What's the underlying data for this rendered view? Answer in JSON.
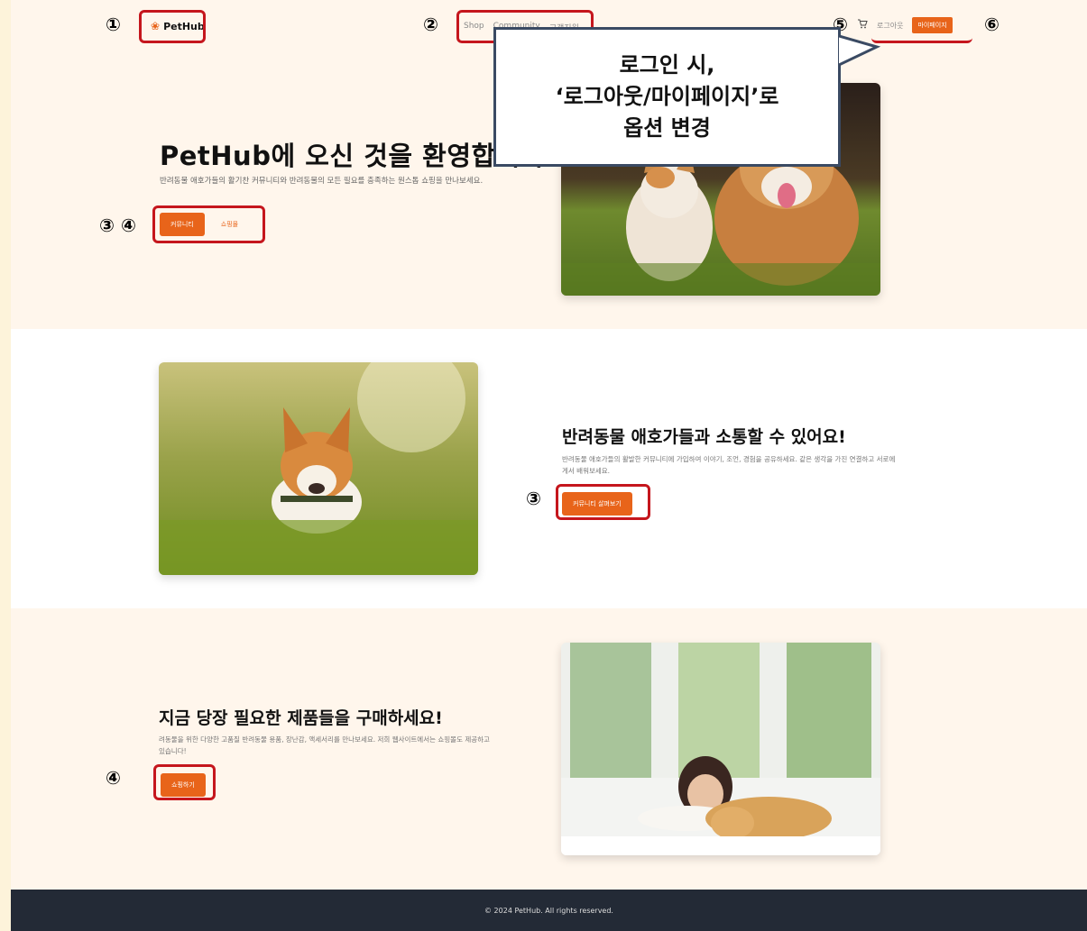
{
  "header": {
    "logo_text": "PetHub",
    "nav": [
      "Shop",
      "Community",
      "고객지원"
    ],
    "cart_icon": "cart-icon",
    "logout_label": "로그아웃",
    "mypage_label": "마이페이지"
  },
  "hero": {
    "title": "PetHub에 오신 것을 환영합니다",
    "description": "반려동물 애호가들의 활기찬 커뮤니티와 반려동물의 모든 필요를 충족하는 원스톱 쇼핑을 만나보세요.",
    "community_button": "커뮤니티",
    "shop_button": "쇼핑몰"
  },
  "community_section": {
    "title": "반려동물 애호가들과 소통할 수 있어요!",
    "description": "반려동물 애호가들의 활발한 커뮤니티에 가입하여 이야기, 조언, 경험을 공유하세요. 같은 생각을 가진 연결하고 서로에게서 배워보세요.",
    "button": "커뮤니티 살펴보기"
  },
  "shop_section": {
    "title": "지금 당장 필요한 제품들을 구매하세요!",
    "description": "려동물을 위한 다양한 고품질 반려동물 용품, 장난감, 액세서리를 만나보세요. 저희 웹사이트에서는 쇼핑몰도 제공하고 있습니다!",
    "button": "쇼핑하기"
  },
  "footer": {
    "copyright": "© 2024 PetHub. All rights reserved."
  },
  "annotations": {
    "n1": "①",
    "n2": "②",
    "n3": "③",
    "n4": "④",
    "n5": "⑤",
    "n6": "⑥",
    "callout_line1": "로그인 시,",
    "callout_line2": "‘로그아웃/마이페이지’로",
    "callout_line3": "옵션 변경"
  },
  "colors": {
    "accent": "#e8641a",
    "annotation_red": "#c5161d",
    "footer_bg": "#232a36",
    "cream_bg": "#fff6ec"
  }
}
